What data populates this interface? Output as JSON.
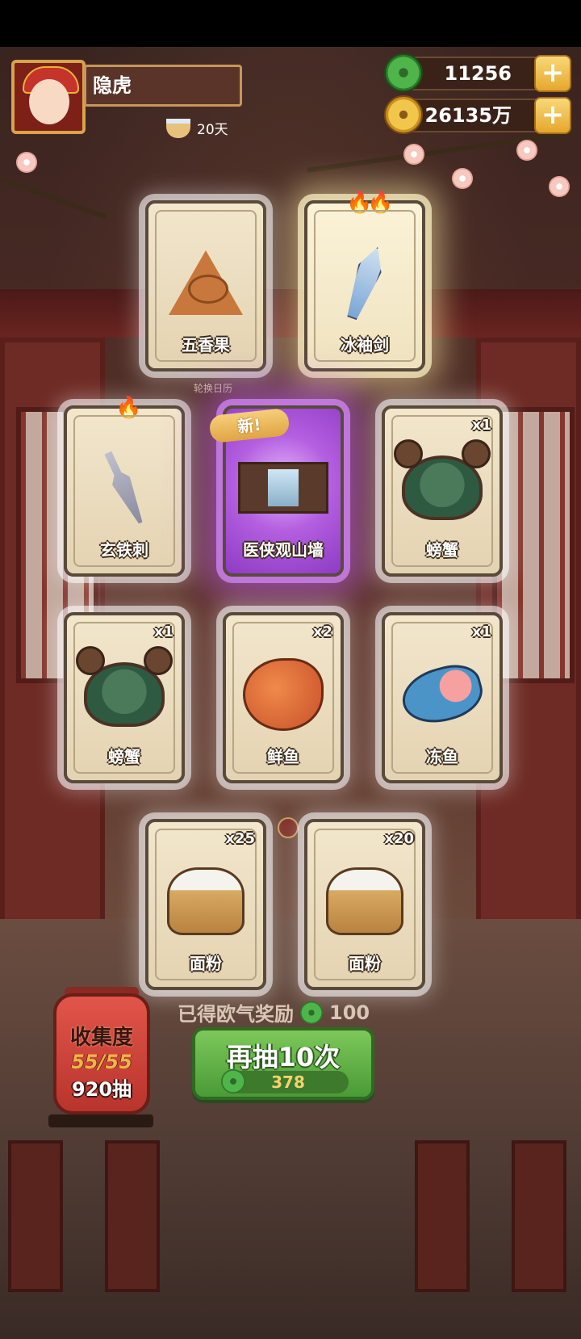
{
  "player": {
    "name": "隐虎",
    "days": "20天"
  },
  "currency": {
    "jade": "11256",
    "coins": "26135万"
  },
  "scene": {
    "calendar_hint": "轮换日历"
  },
  "cards": [
    {
      "label": "五香果",
      "qty": "",
      "art": "triangle-snack-icon",
      "flames": 0
    },
    {
      "label": "冰袖剑",
      "qty": "",
      "art": "ice-sword-icon",
      "flames": 2
    },
    {
      "label": "玄铁刺",
      "qty": "",
      "art": "iron-dagger-icon",
      "flames": 1
    },
    {
      "label": "医侠观山墙",
      "qty": "",
      "art": "mountain-wall-icon",
      "new_tag": "新!"
    },
    {
      "label": "螃蟹",
      "qty": "x1",
      "art": "crab-icon"
    },
    {
      "label": "螃蟹",
      "qty": "x1",
      "art": "crab-icon"
    },
    {
      "label": "鲜鱼",
      "qty": "x2",
      "art": "fresh-fish-icon"
    },
    {
      "label": "冻鱼",
      "qty": "x1",
      "art": "frozen-fish-icon"
    },
    {
      "label": "面粉",
      "qty": "x25",
      "art": "flour-sack-icon"
    },
    {
      "label": "面粉",
      "qty": "x20",
      "art": "flour-sack-icon"
    }
  ],
  "bottom": {
    "reward_text": "已得欧气奖励",
    "reward_amount": "100",
    "collection_title": "收集度",
    "collection_progress": "55/55",
    "draw_count": "920抽",
    "draw_button": "再抽10次",
    "draw_cost": "378"
  },
  "colors": {
    "accent_green": "#4a9a36",
    "gold": "#e6a72c",
    "rare_purple": "#b45ee0"
  }
}
